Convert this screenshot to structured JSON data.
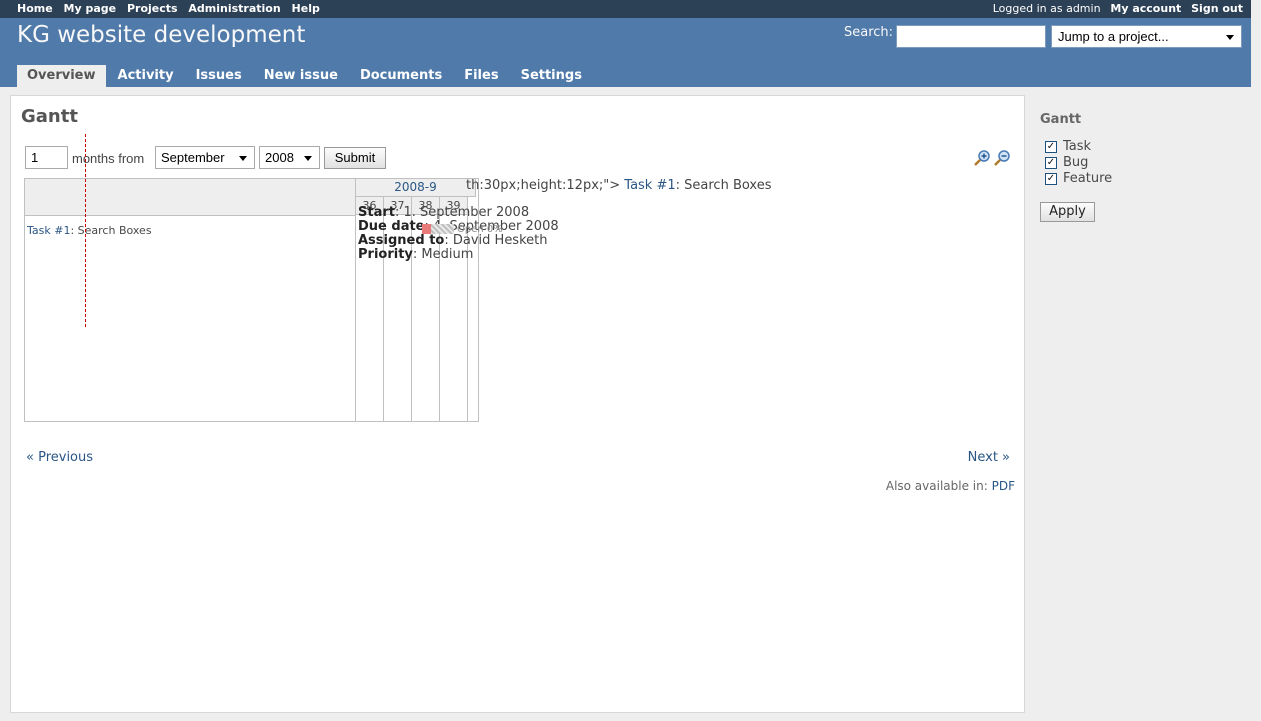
{
  "top_menu": {
    "links": [
      "Home",
      "My page",
      "Projects",
      "Administration",
      "Help"
    ],
    "logged_in_text": "Logged in as admin",
    "my_account": "My account",
    "sign_out": "Sign out"
  },
  "header": {
    "title": "KG website development",
    "search_label": "Search:",
    "search_value": "",
    "jump_select": "Jump to a project..."
  },
  "main_menu": {
    "tabs": [
      "Overview",
      "Activity",
      "Issues",
      "New issue",
      "Documents",
      "Files",
      "Settings"
    ],
    "selected": "Overview"
  },
  "gantt": {
    "heading": "Gantt",
    "months_value": "1",
    "months_label": "months from",
    "month_selected": "September",
    "year_selected": "2008",
    "submit_label": "Submit",
    "month_header": "2008-9",
    "weeks": [
      "36",
      "37",
      "38",
      "39"
    ],
    "task_link": "Task #1",
    "task_title": ": Search Boxes",
    "leak_text": "th:30px;height:12px;\">",
    "tooltip": {
      "start_label": "Start",
      "start_value": ": 1. September 2008",
      "due_label": "Due date",
      "due_value": ": 4. September 2008",
      "assigned_label": "Assigned to",
      "assigned_value": ": David Hesketh",
      "priority_label": "Priority",
      "priority_value": ": Medium"
    },
    "bar_label": "Open 0%",
    "prev": "« Previous",
    "next": "Next »",
    "also_available": "Also available in:",
    "pdf": "PDF"
  },
  "sidebar": {
    "heading": "Gantt",
    "trackers": [
      {
        "label": "Task",
        "checked": true
      },
      {
        "label": "Bug",
        "checked": true
      },
      {
        "label": "Feature",
        "checked": true
      }
    ],
    "apply_label": "Apply"
  },
  "colors": {
    "header_bg": "#507aaa",
    "top_menu_bg": "#2c4056",
    "link": "#2a5685"
  },
  "icons": [
    "zoom-in-icon",
    "zoom-out-icon",
    "checkbox-checked-icon",
    "dropdown-arrow-icon"
  ]
}
